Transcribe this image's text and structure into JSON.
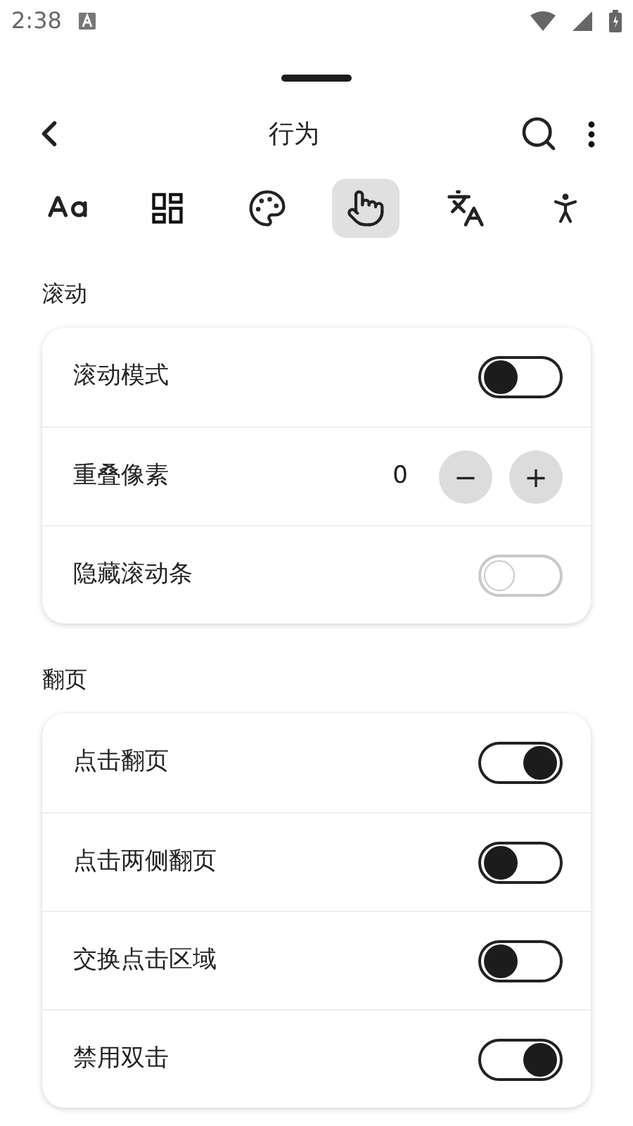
{
  "status_bar": {
    "time": "2:38"
  },
  "header": {
    "title": "行为"
  },
  "tabs": [
    {
      "selected": false
    },
    {
      "selected": false
    },
    {
      "selected": false
    },
    {
      "selected": true
    },
    {
      "selected": false
    },
    {
      "selected": false
    }
  ],
  "sections": [
    {
      "title": "滚动",
      "rows": [
        {
          "kind": "toggle",
          "label": "滚动模式",
          "on": false,
          "disabled": false
        },
        {
          "kind": "stepper",
          "label": "重叠像素",
          "value": "0",
          "minus": "−",
          "plus": "+"
        },
        {
          "kind": "toggle",
          "label": "隐藏滚动条",
          "on": false,
          "disabled": true
        }
      ]
    },
    {
      "title": "翻页",
      "rows": [
        {
          "kind": "toggle",
          "label": "点击翻页",
          "on": true,
          "disabled": false
        },
        {
          "kind": "toggle",
          "label": "点击两侧翻页",
          "on": false,
          "disabled": false
        },
        {
          "kind": "toggle",
          "label": "交换点击区域",
          "on": false,
          "disabled": false
        },
        {
          "kind": "toggle",
          "label": "禁用双击",
          "on": true,
          "disabled": false
        }
      ]
    }
  ]
}
